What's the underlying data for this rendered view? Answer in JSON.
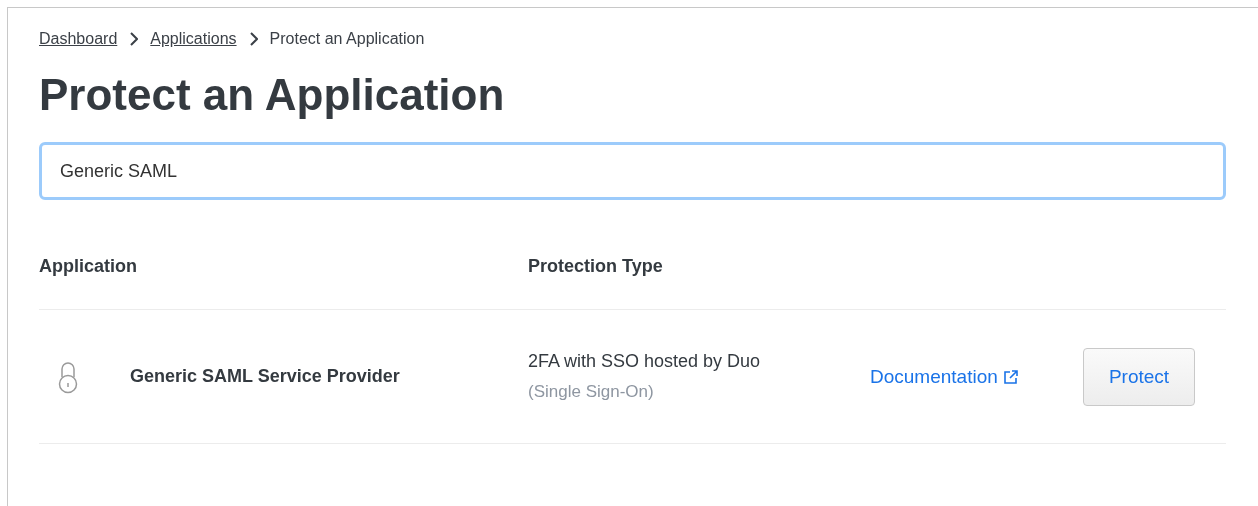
{
  "breadcrumb": [
    {
      "label": "Dashboard",
      "kind": "link"
    },
    {
      "label": "Applications",
      "kind": "link"
    },
    {
      "label": "Protect an Application",
      "kind": "current"
    }
  ],
  "title": "Protect an Application",
  "search": {
    "value": "Generic SAML"
  },
  "table": {
    "columns": [
      "Application",
      "Protection Type"
    ],
    "rows": [
      {
        "name": "Generic SAML Service Provider",
        "protection": "2FA with SSO hosted by Duo",
        "protection_note": "(Single Sign-On)",
        "link": "Documentation",
        "button": "Protect"
      }
    ]
  }
}
